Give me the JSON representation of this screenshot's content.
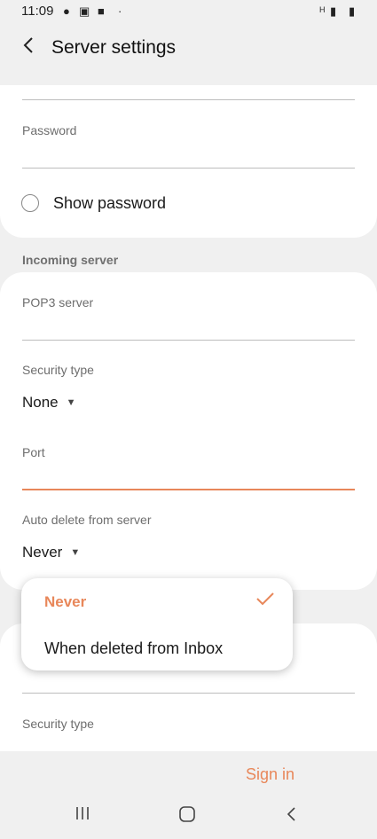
{
  "status_bar": {
    "time": "11:09",
    "network_label": "H"
  },
  "header": {
    "title": "Server settings"
  },
  "account_card": {
    "password_label": "Password",
    "show_password_label": "Show password"
  },
  "incoming": {
    "section_title": "Incoming server",
    "pop3_label": "POP3 server",
    "security_type_label": "Security type",
    "security_type_value": "None",
    "port_label": "Port",
    "auto_delete_label": "Auto delete from server",
    "auto_delete_value": "Never"
  },
  "dropdown": {
    "options": [
      "Never",
      "When deleted from Inbox"
    ],
    "selected": "Never"
  },
  "outgoing": {
    "security_type_label": "Security type"
  },
  "footer": {
    "sign_in_label": "Sign in"
  },
  "colors": {
    "accent": "#e8875a",
    "background": "#f0f0f0"
  }
}
